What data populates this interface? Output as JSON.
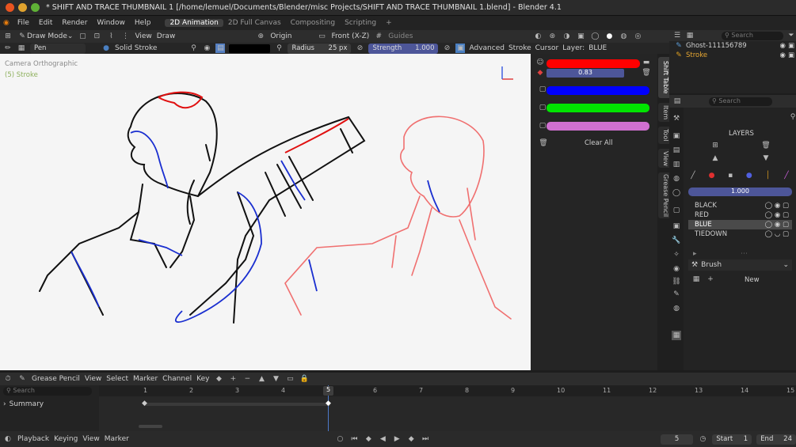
{
  "window": {
    "title": "* SHIFT AND TRACE THUMBNAIL 1 [/home/lemuel/Documents/Blender/misc Projects/SHIFT AND TRACE THUMBNAIL 1.blend] - Blender 4.1"
  },
  "menu": {
    "items": [
      "File",
      "Edit",
      "Render",
      "Window",
      "Help"
    ],
    "workspaces": [
      "2D Animation",
      "2D Full Canvas",
      "Compositing",
      "Scripting"
    ],
    "add": "+"
  },
  "header": {
    "mode": "Draw Mode",
    "view": "View",
    "draw": "Draw",
    "origin": "Origin",
    "orientation": "Front (X-Z)",
    "guides": "Guides"
  },
  "tool": {
    "brush": "Pen",
    "stroke_type": "Solid Stroke",
    "radius_label": "Radius",
    "radius_value": "25 px",
    "strength_label": "Strength",
    "strength_value": "1.000",
    "advanced": "Advanced",
    "stroke": "Stroke",
    "cursor": "Cursor",
    "layer_label": "Layer:",
    "layer_value": "BLUE"
  },
  "viewport": {
    "camera": "Camera Orthographic",
    "object": "(5) Stroke"
  },
  "shift_table": {
    "value": "0.83",
    "clear_all": "Clear All",
    "tabs": [
      "Shift Table",
      "Item",
      "Tool",
      "View",
      "Grease Pencil"
    ],
    "colors": [
      "#ff0000",
      "#0000ff",
      "#00e400",
      "#d070d0"
    ]
  },
  "outliner": {
    "search": "Search",
    "items": [
      "Ghost-111156789",
      "Stroke"
    ]
  },
  "properties": {
    "search": "Search",
    "layers_title": "LAYERS",
    "opacity": "1.000",
    "layers": [
      "BLACK",
      "RED",
      "BLUE",
      "TIEDOWN"
    ],
    "active_layer": "BLUE",
    "brush": "Brush",
    "new": "New"
  },
  "dopesheet": {
    "mode": "Grease Pencil",
    "menus": [
      "View",
      "Select",
      "Marker",
      "Channel",
      "Key"
    ],
    "search": "Search",
    "summary": "Summary",
    "frames": [
      "1",
      "2",
      "3",
      "4",
      "5",
      "6",
      "7",
      "8",
      "9",
      "10",
      "11",
      "12",
      "13",
      "14",
      "15"
    ],
    "current": "5"
  },
  "timeline": {
    "menus": [
      "Playback",
      "Keying",
      "View",
      "Marker"
    ],
    "frame": "5",
    "start_label": "Start",
    "start": "1",
    "end_label": "End",
    "end": "24"
  }
}
